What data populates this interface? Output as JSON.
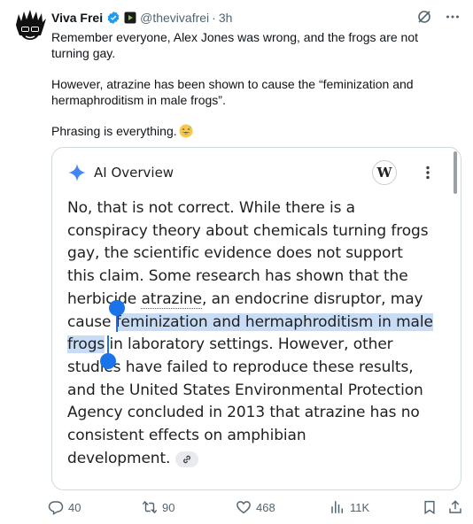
{
  "post": {
    "display_name": "Viva Frei",
    "handle": "@thevivafrei",
    "separator": "·",
    "time": "3h",
    "paragraphs": [
      "Remember everyone, Alex Jones was wrong, and the frogs are not turning gay.",
      "However, atrazine has been shown to cause the “feminization and hermaphroditism in male frogs”.",
      "Phrasing is everything."
    ],
    "emoji": "grinning-sweat-emoji"
  },
  "card": {
    "title": "AI Overview",
    "wiki_letter": "W",
    "lines": {
      "l1": "No, that is not correct. While there is a",
      "l2": "conspiracy theory about chemicals turning frogs",
      "l3": "gay, the scientific evidence does not support",
      "l4": "this claim. Some research has shown that the",
      "l5a": "herbicide ",
      "l5b": "atrazine",
      "l5c": ", an endocrine disruptor, may",
      "l6a": "cause ",
      "l6b": "feminization and hermaphroditism in male",
      "l7a": "frogs",
      "l7b": " in laboratory settings. However, other",
      "l8": "studies have failed to reproduce these results,",
      "l9": "and the United States Environmental Protection",
      "l10": "Agency concluded in 2013 that atrazine has no",
      "l11": "consistent effects on amphibian",
      "l12": "development."
    }
  },
  "actions": {
    "replies": "40",
    "reposts": "90",
    "likes": "468",
    "views": "11K"
  },
  "colors": {
    "accent": "#1d9bf0",
    "selection": "#c8dcf5",
    "handle": "#1a73e8",
    "muted": "#536471"
  }
}
